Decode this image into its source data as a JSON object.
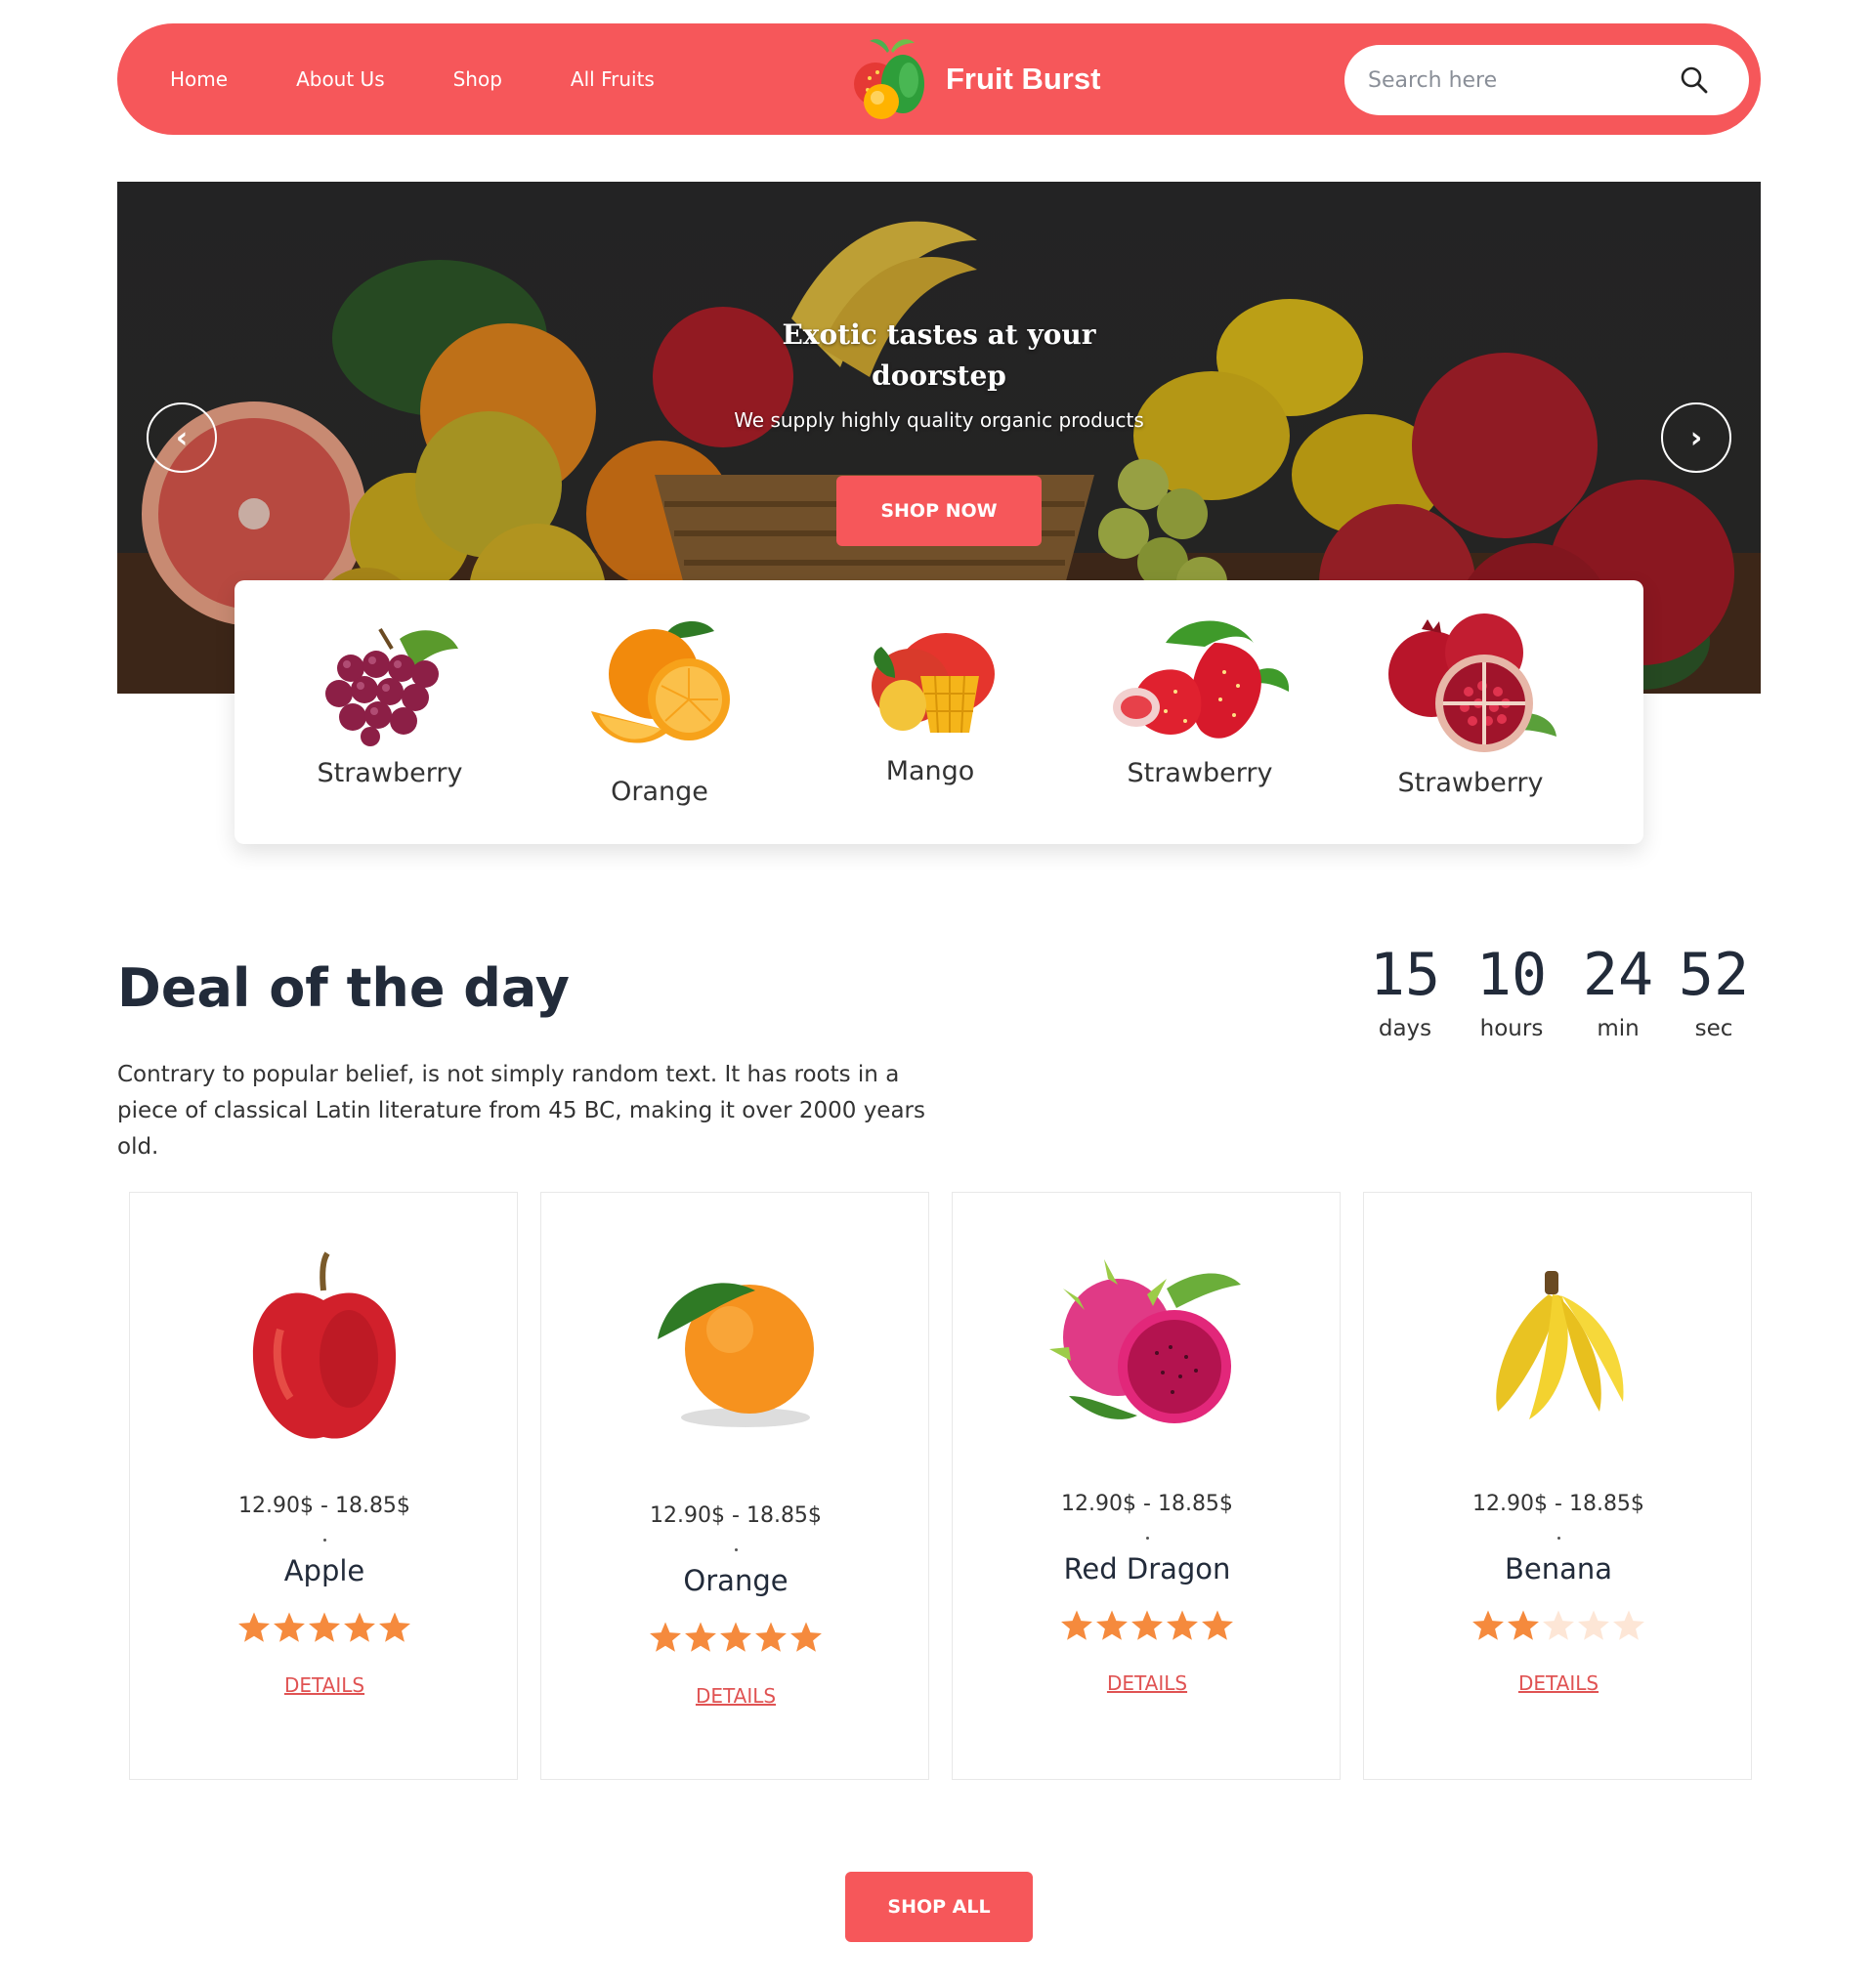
{
  "nav": {
    "links": [
      "Home",
      "About Us",
      "Shop",
      "All Fruits"
    ],
    "brand_name": "Fruit Burst",
    "search_placeholder": "Search here",
    "accent_color": "#f6575a"
  },
  "hero": {
    "title": "Exotic tastes at your doorstep",
    "subtitle": "We supply highly quality organic products",
    "button": "SHOP NOW",
    "prev_icon": "‹",
    "next_icon": "›"
  },
  "categories": [
    {
      "label": "Strawberry",
      "icon": "grapes-image"
    },
    {
      "label": "Orange",
      "icon": "orange-image"
    },
    {
      "label": "Mango",
      "icon": "mango-image"
    },
    {
      "label": "Strawberry",
      "icon": "strawberry-image"
    },
    {
      "label": "Strawberry",
      "icon": "pomegranate-image"
    }
  ],
  "deal": {
    "title": "Deal of the day",
    "description": "Contrary to popular belief, is not simply random text. It has roots in a piece of classical Latin literature from 45 BC, making it over 2000 years old.",
    "countdown": [
      {
        "value": "15",
        "label": "days"
      },
      {
        "value": "10",
        "label": "hours"
      },
      {
        "value": "24",
        "label": "min"
      },
      {
        "value": "52",
        "label": "sec"
      }
    ]
  },
  "products": [
    {
      "name": "Apple",
      "price": "12.90$ - 18.85$",
      "rating": 5,
      "rating_max": 5,
      "details": "DETAILS",
      "icon": "apple-image"
    },
    {
      "name": "Orange",
      "price": "12.90$ - 18.85$",
      "rating": 5,
      "rating_max": 5,
      "details": "DETAILS",
      "icon": "orange-image"
    },
    {
      "name": "Red Dragon",
      "price": "12.90$ - 18.85$",
      "rating": 5,
      "rating_max": 5,
      "details": "DETAILS",
      "icon": "dragon-fruit-image"
    },
    {
      "name": "Benana",
      "price": "12.90$ - 18.85$",
      "rating": 2,
      "rating_max": 5,
      "details": "DETAILS",
      "icon": "banana-image"
    }
  ],
  "shop_all": "SHOP ALL",
  "colors": {
    "star_filled": "#f58a3d",
    "star_empty": "#fde6d6"
  }
}
